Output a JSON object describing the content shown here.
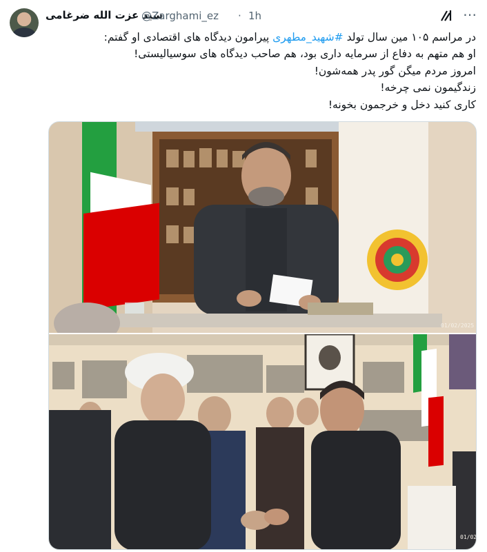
{
  "tweet": {
    "author_name": "سید عزت الله ضرغامی",
    "handle": "@Zarghami_ez",
    "separator": "·",
    "time": "1h",
    "text_lines": [
      {
        "before": "در مراسم ۱۰۵ مین سال تولد ",
        "hashtag": "#شهید_مطهری",
        "after": " پیرامون دیدگاه های اقتصادی او گفتم:"
      },
      "او هم متهم به دفاع از سرمایه داری بود، هم صاحب دیدگاه های سوسیالیستی!",
      "امروز مردم میگن گور پدر همه‌شون!",
      "زندگیمون نمی چرخه!",
      "کاری کنید دخل و خرجمون بخونه!"
    ]
  },
  "icons": {
    "avatar": "profile-avatar",
    "grok": "grok-icon",
    "more": "more-icon"
  },
  "media": {
    "photo1_timestamp": "01/02/2025",
    "photo2_timestamp": "01/02"
  },
  "colors": {
    "text": "#0f1419",
    "secondary": "#536471",
    "link": "#1d9bf0"
  }
}
